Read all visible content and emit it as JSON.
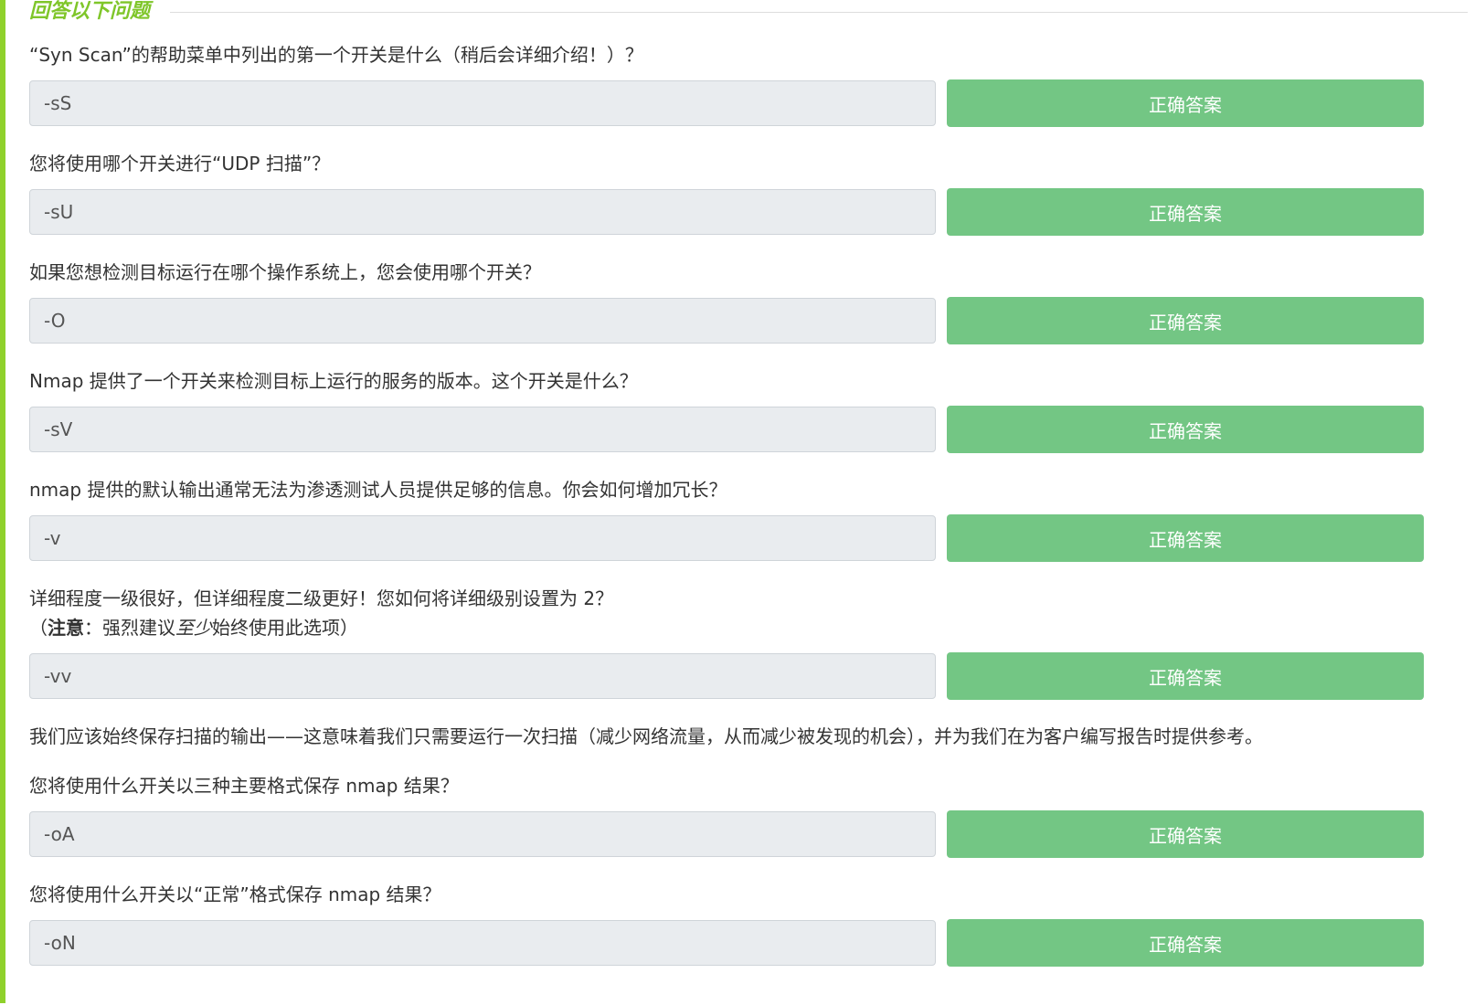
{
  "section": {
    "title": "回答以下问题"
  },
  "qa": [
    {
      "question_parts": [
        {
          "text": "“Syn Scan”的帮助菜单中列出的第一个开关是什么（稍后会详细介绍！）？",
          "style": "normal"
        }
      ],
      "answer": "-sS",
      "button_label": "正确答案"
    },
    {
      "question_parts": [
        {
          "text": "您将使用哪个开关进行“UDP 扫描”？",
          "style": "normal"
        }
      ],
      "answer": "-sU",
      "button_label": "正确答案"
    },
    {
      "question_parts": [
        {
          "text": "如果您想检测目标运行在哪个操作系统上，您会使用哪个开关？",
          "style": "normal"
        }
      ],
      "answer": "-O",
      "button_label": "正确答案"
    },
    {
      "question_parts": [
        {
          "text": "Nmap 提供了一个开关来检测目标上运行的服务的版本。这个开关是什么？",
          "style": "normal"
        }
      ],
      "answer": "-sV",
      "button_label": "正确答案"
    },
    {
      "question_parts": [
        {
          "text": "nmap 提供的默认输出通常无法为渗透测试人员提供足够的信息。你会如何增加冗长？",
          "style": "normal"
        }
      ],
      "answer": "-v",
      "button_label": "正确答案"
    },
    {
      "question_line1": "详细程度一级很好，但详细程度二级更好！您如何将详细级别设置为 2？",
      "question_line2_parts": [
        {
          "text": "（",
          "style": "normal"
        },
        {
          "text": "注意",
          "style": "bold"
        },
        {
          "text": "：强烈建议",
          "style": "normal"
        },
        {
          "text": "至少",
          "style": "italic"
        },
        {
          "text": "始终使用此选项）",
          "style": "normal"
        }
      ],
      "answer": "-vv",
      "button_label": "正确答案"
    }
  ],
  "note": "我们应该始终保存扫描的输出——这意味着我们只需要运行一次扫描（减少网络流量，从而减少被发现的机会），并为我们在为客户编写报告时提供参考。",
  "qa2": [
    {
      "question": "您将使用什么开关以三种主要格式保存 nmap 结果？",
      "answer": "-oA",
      "button_label": "正确答案"
    },
    {
      "question": "您将使用什么开关以“正常”格式保存 nmap 结果？",
      "answer": "-oN",
      "button_label": "正确答案"
    }
  ],
  "colors": {
    "accent_bar": "#8fd12b",
    "section_title": "#7fc62a",
    "button_bg": "#73c684",
    "input_bg": "#e9ecef"
  }
}
